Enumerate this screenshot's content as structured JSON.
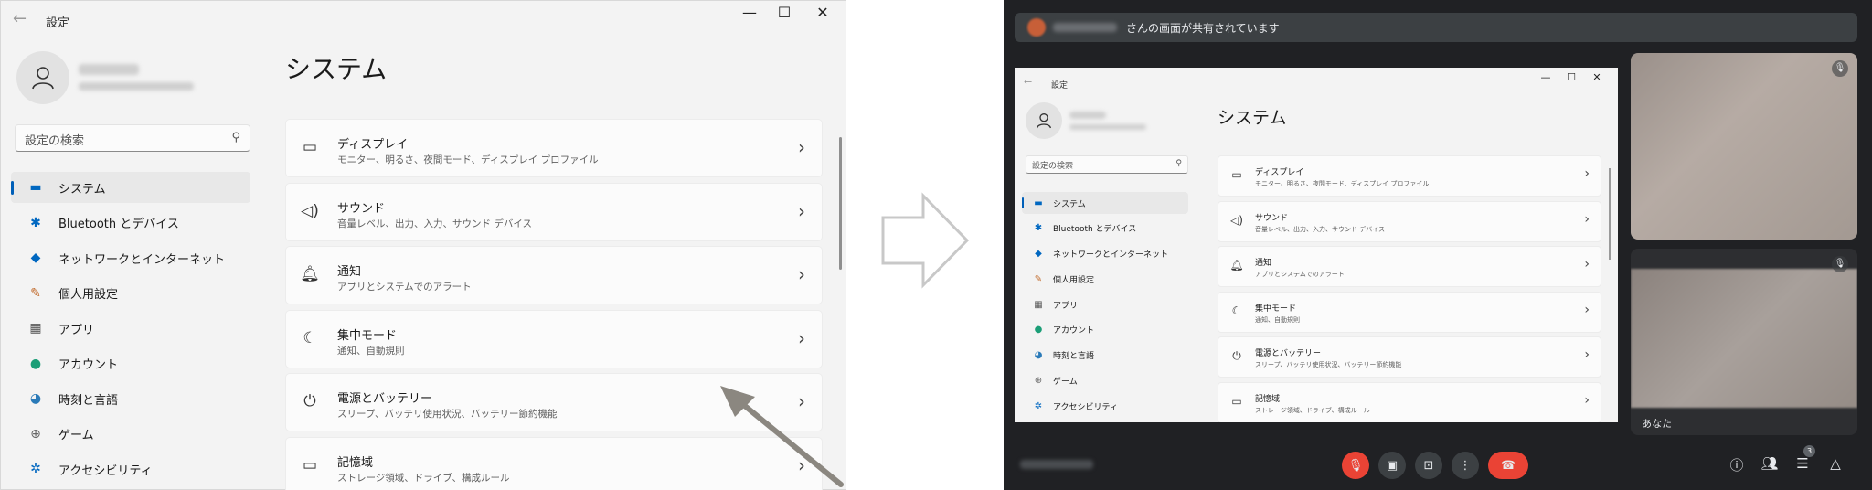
{
  "settings": {
    "title": "設定",
    "controls": {
      "minimize": "—",
      "maximize": "☐",
      "close": "✕"
    },
    "search_placeholder": "設定の検索",
    "page_title": "システム",
    "nav": [
      {
        "label": "システム",
        "icon": "monitor-icon"
      },
      {
        "label": "Bluetooth とデバイス",
        "icon": "bluetooth-icon"
      },
      {
        "label": "ネットワークとインターネット",
        "icon": "wifi-icon"
      },
      {
        "label": "個人用設定",
        "icon": "brush-icon"
      },
      {
        "label": "アプリ",
        "icon": "apps-icon"
      },
      {
        "label": "アカウント",
        "icon": "account-icon"
      },
      {
        "label": "時刻と言語",
        "icon": "globe-icon"
      },
      {
        "label": "ゲーム",
        "icon": "gamepad-icon"
      },
      {
        "label": "アクセシビリティ",
        "icon": "accessibility-icon"
      }
    ],
    "cards": [
      {
        "title": "ディスプレイ",
        "subtitle": "モニター、明るさ、夜間モード、ディスプレイ プロファイル",
        "icon": "display-icon"
      },
      {
        "title": "サウンド",
        "subtitle": "音量レベル、出力、入力、サウンド デバイス",
        "icon": "speaker-icon"
      },
      {
        "title": "通知",
        "subtitle": "アプリとシステムでのアラート",
        "icon": "bell-icon"
      },
      {
        "title": "集中モード",
        "subtitle": "通知、自動規則",
        "icon": "moon-icon"
      },
      {
        "title": "電源とバッテリー",
        "subtitle": "スリープ、バッテリ使用状況、バッテリー節約機能",
        "icon": "power-icon"
      },
      {
        "title": "記憶域",
        "subtitle": "ストレージ領域、ドライブ、構成ルール",
        "icon": "storage-icon"
      }
    ],
    "shared_cards": [
      {
        "title": "ディスプレイ",
        "subtitle": "モニター、明るさ、夜間モード、ディスプレイ プロファイル"
      },
      {
        "title": "サウンド",
        "subtitle": "音量レベル、出力、入力、サウンド デバイス"
      },
      {
        "title": "通知",
        "subtitle": "アプリとシステムでのアラート"
      },
      {
        "title": "集中モード",
        "subtitle": "通知、自動規則"
      },
      {
        "title": "電源とバッテリー",
        "subtitle": "スリープ、バッテリ使用状況、バッテリー節約機能"
      },
      {
        "title": "記憶域",
        "subtitle": "ストレージ領域、ドライブ、構成ルール"
      }
    ]
  },
  "meeting": {
    "share_text": "さんの画面が共有されています",
    "self_label": "あなた",
    "participant_count": "3",
    "colors": {
      "background": "#202124",
      "end_call": "#ea4335",
      "mic_off": "#ea4335"
    },
    "controls": [
      "mic-off-icon",
      "camera-icon",
      "present-icon",
      "more-icon",
      "end-call-icon"
    ],
    "right_controls": [
      "info-icon",
      "people-icon",
      "chat-icon",
      "activities-icon"
    ]
  }
}
